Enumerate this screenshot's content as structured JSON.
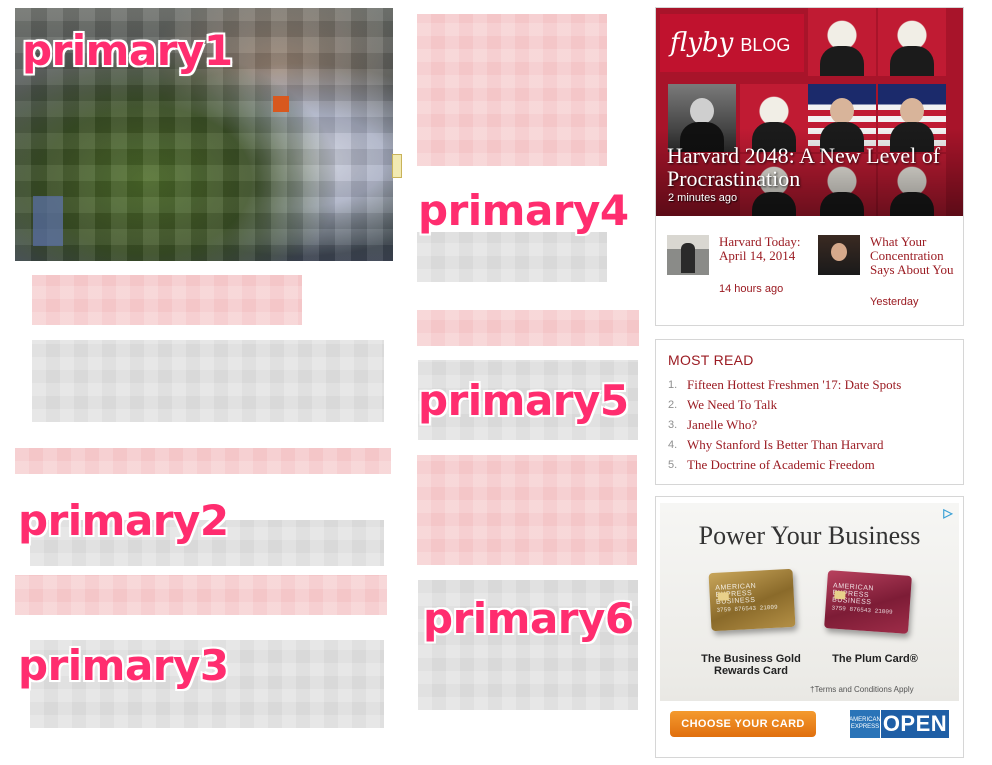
{
  "labels": {
    "primary1": "primary1",
    "primary2": "primary2",
    "primary3": "primary3",
    "primary4": "primary4",
    "primary5": "primary5",
    "primary6": "primary6"
  },
  "flyby": {
    "logo_word": "flyby",
    "logo_blog": "BLOG",
    "hero_title": "Harvard 2048: A New Level of Procrastination",
    "hero_time": "2 minutes ago",
    "stories": [
      {
        "title": "Harvard Today: April 14, 2014",
        "time": "14 hours ago"
      },
      {
        "title": "What Your Concentration Says About You",
        "time": "Yesterday"
      }
    ]
  },
  "most_read": {
    "heading": "MOST READ",
    "items": [
      {
        "num": "1.",
        "title": "Fifteen Hottest Freshmen '17: Date Spots"
      },
      {
        "num": "2.",
        "title": "We Need To Talk"
      },
      {
        "num": "3.",
        "title": "Janelle Who?"
      },
      {
        "num": "4.",
        "title": "Why Stanford Is Better Than Harvard"
      },
      {
        "num": "5.",
        "title": "The Doctrine of Academic Freedom"
      }
    ]
  },
  "ad": {
    "headline": "Power Your Business",
    "card1_brand": "AMERICAN EXPRESS BUSINESS",
    "card1_number": "3759 876543 21009",
    "card2_brand": "AMERICAN EXPRESS BUSINESS",
    "card2_number": "3759 876543 21009",
    "card1_caption": "The Business Gold Rewards Card",
    "card2_caption": "The Plum Card®",
    "terms": "†Terms and Conditions Apply",
    "cta": "CHOOSE YOUR CARD",
    "amex_label": "AMERICAN EXPRESS",
    "open_label": "OPEN",
    "adchoices_icon": "adchoices-icon"
  }
}
